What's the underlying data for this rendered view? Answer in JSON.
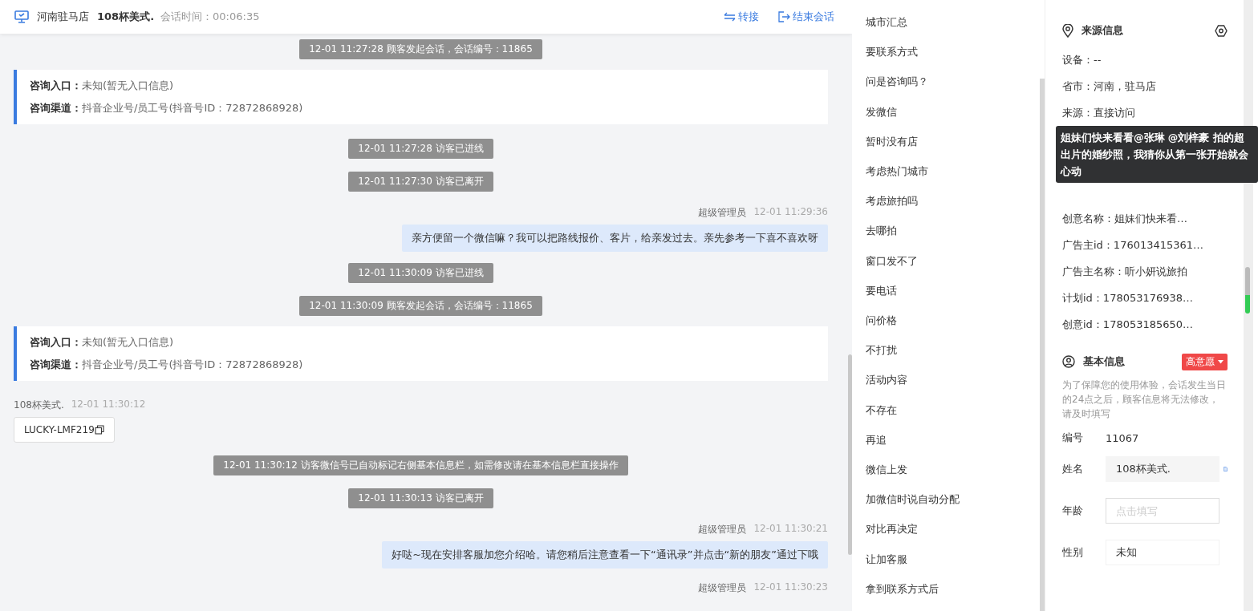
{
  "header": {
    "store": "河南驻马店",
    "customer": "108杯美式.",
    "duration_label": "会话时间：",
    "duration": "00:06:35",
    "actions": [
      {
        "kind": "transfer",
        "label": "转接"
      },
      {
        "kind": "end",
        "label": "结束会话"
      }
    ]
  },
  "messages": [
    {
      "kind": "system",
      "text": "12-01 11:27:28 顾客发起会话，会话编号：11865"
    },
    {
      "kind": "info",
      "entry_label": "咨询入口：",
      "entry": "未知(暂无入口信息)",
      "channel_label": "咨询渠道：",
      "channel": "抖音企业号/员工号(抖音号ID：72872868928)"
    },
    {
      "kind": "system",
      "text": "12-01 11:27:28 访客已进线"
    },
    {
      "kind": "system",
      "text": "12-01 11:27:30 访客已离开"
    },
    {
      "kind": "agent",
      "sender": "超级管理员",
      "time": "12-01 11:29:36",
      "text": "亲方便留一个微信嘛？我可以把路线报价、客片，给亲发过去。亲先参考一下喜不喜欢呀"
    },
    {
      "kind": "system",
      "text": "12-01 11:30:09 访客已进线"
    },
    {
      "kind": "system",
      "text": "12-01 11:30:09 顾客发起会话，会话编号：11865"
    },
    {
      "kind": "info",
      "entry_label": "咨询入口：",
      "entry": "未知(暂无入口信息)",
      "channel_label": "咨询渠道：",
      "channel": "抖音企业号/员工号(抖音号ID：72872868928)"
    },
    {
      "kind": "visitor",
      "sender": "108杯美式.",
      "time": "12-01 11:30:12",
      "text": "LUCKY-LMF219"
    },
    {
      "kind": "system",
      "text": "12-01 11:30:12 访客微信号已自动标记右侧基本信息栏，如需修改请在基本信息栏直接操作"
    },
    {
      "kind": "system",
      "text": "12-01 11:30:13 访客已离开"
    },
    {
      "kind": "agent",
      "sender": "超级管理员",
      "time": "12-01 11:30:21",
      "text": "好哒~现在安排客服加您介绍哈。请您稍后注意查看一下“通讯录”并点击“新的朋友”通过下哦"
    },
    {
      "kind": "agent",
      "sender": "超级管理员",
      "time": "12-01 11:30:23"
    }
  ],
  "quick_replies": [
    "城市汇总",
    "要联系方式",
    "问是咨询吗？",
    "发微信",
    "暂时没有店",
    "考虑热门城市",
    "考虑旅拍吗",
    "去哪拍",
    "窗口发不了",
    "要电话",
    "问价格",
    "不打扰",
    "活动内容",
    "不存在",
    "再追",
    "微信上发",
    "加微信时说自动分配",
    "对比再决定",
    "让加客服",
    "拿到联系方式后"
  ],
  "source_info": {
    "title": "来源信息",
    "rows_above": [
      "设备：--",
      "省市：河南，驻马店",
      "来源：直接访问"
    ],
    "tooltip": "姐妹们快来看看@张琳 @刘梓豪 拍的超出片的婚纱照，我猜你从第一张开始就会心动",
    "rows_below": [
      "创意名称：姐妹们快来看…",
      "广告主id：176013415361…",
      "广告主名称：听小妍说旅拍",
      "计划id：178053176938…",
      "创意id：178053185650…"
    ]
  },
  "basic_info": {
    "title": "基本信息",
    "tag": "高意愿",
    "notice": "为了保障您的使用体验，会话发生当日的24点之后，顾客信息将无法修改，请及时填写",
    "fields": [
      {
        "kind": "text",
        "label": "编号",
        "value": "11067"
      },
      {
        "kind": "filled",
        "label": "姓名",
        "value": "108杯美式."
      },
      {
        "kind": "input",
        "label": "年龄",
        "placeholder": "点击填写"
      },
      {
        "kind": "select",
        "label": "性别",
        "value": "未知"
      }
    ]
  }
}
